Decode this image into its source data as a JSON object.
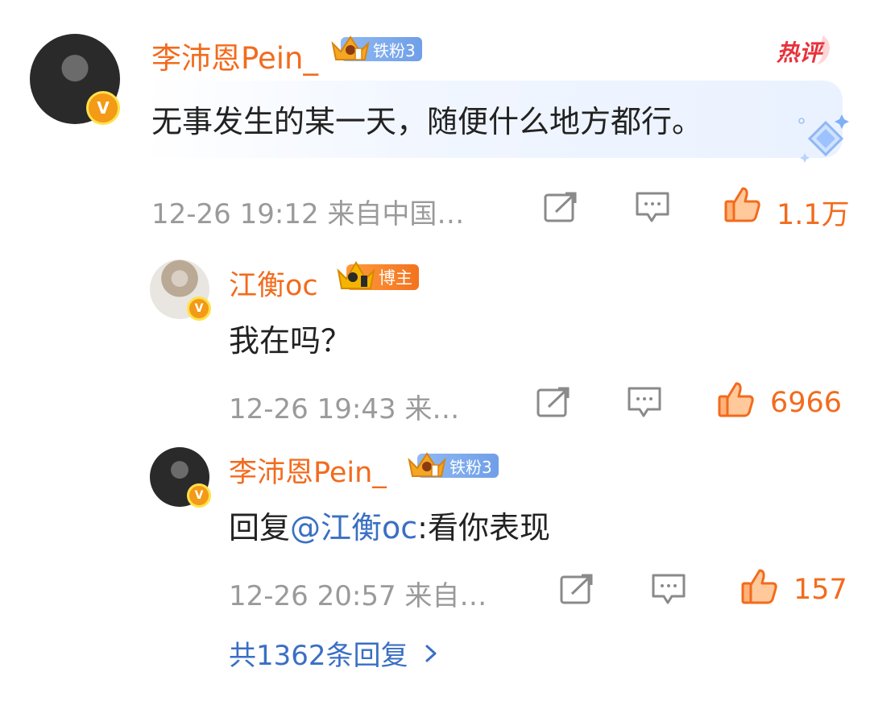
{
  "comment": {
    "author": "李沛恩Pein_",
    "fan_badge": "铁粉3",
    "hot_tag": "热评",
    "text": "无事发生的某一天，随便什么地方都行。",
    "time_source": "12-26 19:12 来自中国…",
    "likes": "1.1万"
  },
  "replies": [
    {
      "author": "江衡oc",
      "badge": "博主",
      "text": "我在吗？",
      "time_source": "12-26 19:43 来…",
      "likes": "6966"
    },
    {
      "author": "李沛恩Pein_",
      "badge": "铁粉3",
      "reply_prefix": "回复",
      "mention": "@江衡oc",
      "text_after": ":看你表现",
      "time_source": "12-26 20:57 来自…",
      "likes": "157"
    }
  ],
  "more_replies": "共1362条回复",
  "verified_mark": "V",
  "icons": [
    "share-icon",
    "comment-icon",
    "like-icon",
    "crown-icon",
    "chevron-right-icon"
  ],
  "colors": {
    "accent": "#f26b1d",
    "link": "#3a6fc4",
    "meta": "#9a9a9a",
    "badge_blue": "#7aa7ee"
  }
}
